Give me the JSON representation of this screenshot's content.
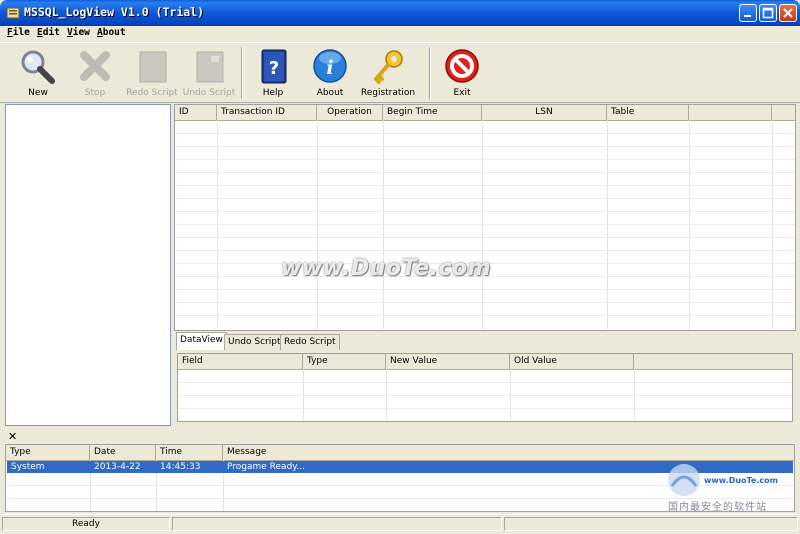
{
  "window": {
    "title": "MSSQL_LogView V1.0 (Trial)"
  },
  "menu": [
    "File",
    "Edit",
    "View",
    "About"
  ],
  "toolbar": {
    "new": "New",
    "stop": "Stop",
    "redo_script": "Redo Script",
    "undo_script": "Undo Script",
    "help": "Help",
    "about": "About",
    "registration": "Registration",
    "exit": "Exit"
  },
  "transactions": {
    "columns": [
      "ID",
      "Transaction ID",
      "Operation",
      "Begin Time",
      "LSN",
      "Table"
    ]
  },
  "tabs": [
    "DataView",
    "Undo Script",
    "Redo Script"
  ],
  "dataview": {
    "columns": [
      "Field",
      "Type",
      "New Value",
      "Old Value"
    ]
  },
  "log": {
    "columns": [
      "Type",
      "Date",
      "Time",
      "Message"
    ],
    "rows": [
      {
        "type": "System",
        "date": "2013-4-22",
        "time": "14:45:33",
        "message": "Progame Ready..."
      }
    ]
  },
  "status": {
    "text": "Ready"
  },
  "watermark": {
    "text": "www.DuoTe.com",
    "domain": "www.DuoTe.com",
    "cn": "国内最安全的软件站"
  },
  "colors": {
    "title_bar": "#0a5fd8",
    "selection": "#316ac5"
  }
}
